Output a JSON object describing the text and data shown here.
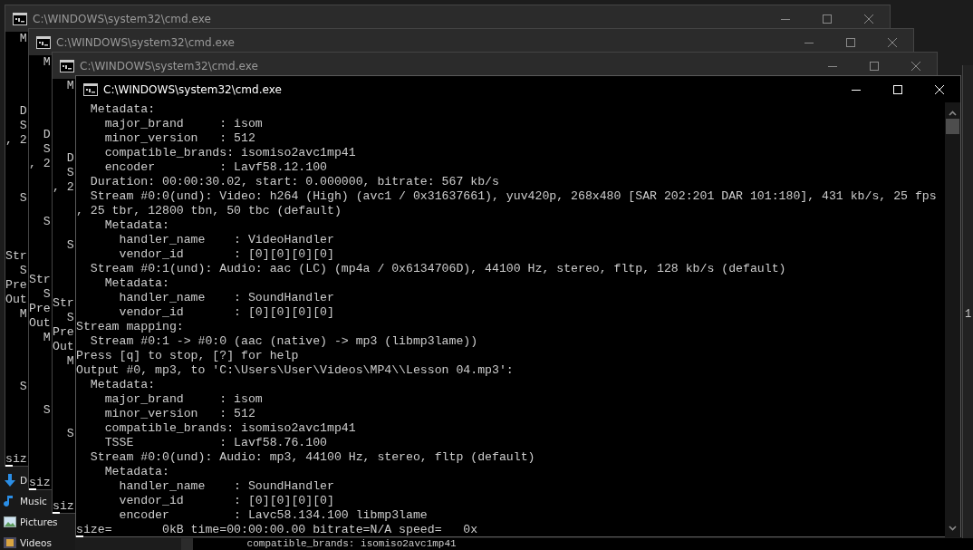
{
  "windows": [
    {
      "title": "C:\\WINDOWS\\system32\\cmd.exe",
      "active": false,
      "lines": [
        {
          "text": "  M"
        },
        {
          "kind": "blank"
        },
        {
          "kind": "blank"
        },
        {
          "kind": "blank"
        },
        {
          "kind": "blank"
        },
        {
          "text": "  D"
        },
        {
          "text": "  S"
        },
        {
          "text": ", 2"
        },
        {
          "kind": "blank"
        },
        {
          "kind": "blank"
        },
        {
          "kind": "blank"
        },
        {
          "text": "  S"
        },
        {
          "kind": "blank"
        },
        {
          "kind": "blank"
        },
        {
          "kind": "blank"
        },
        {
          "text": "Str"
        },
        {
          "text": "  S"
        },
        {
          "text": "Pre"
        },
        {
          "text": "Out"
        },
        {
          "text": "  M"
        },
        {
          "kind": "blank"
        },
        {
          "kind": "blank"
        },
        {
          "kind": "blank"
        },
        {
          "kind": "blank"
        },
        {
          "text": "  S"
        },
        {
          "kind": "blank"
        },
        {
          "kind": "blank"
        },
        {
          "kind": "blank"
        },
        {
          "kind": "blank"
        },
        {
          "text": "siz"
        }
      ]
    },
    {
      "title": "C:\\WINDOWS\\system32\\cmd.exe",
      "active": false,
      "lines": [
        {
          "text": "  M"
        },
        {
          "kind": "blank"
        },
        {
          "kind": "blank"
        },
        {
          "kind": "blank"
        },
        {
          "kind": "blank"
        },
        {
          "text": "  D"
        },
        {
          "text": "  S"
        },
        {
          "text": ", 2"
        },
        {
          "kind": "blank"
        },
        {
          "kind": "blank"
        },
        {
          "kind": "blank"
        },
        {
          "text": "  S"
        },
        {
          "kind": "blank"
        },
        {
          "kind": "blank"
        },
        {
          "kind": "blank"
        },
        {
          "text": "Str"
        },
        {
          "text": "  S"
        },
        {
          "text": "Pre"
        },
        {
          "text": "Out"
        },
        {
          "text": "  M"
        },
        {
          "kind": "blank"
        },
        {
          "kind": "blank"
        },
        {
          "kind": "blank"
        },
        {
          "kind": "blank"
        },
        {
          "text": "  S"
        },
        {
          "kind": "blank"
        },
        {
          "kind": "blank"
        },
        {
          "kind": "blank"
        },
        {
          "kind": "blank"
        },
        {
          "text": "siz"
        }
      ]
    },
    {
      "title": "C:\\WINDOWS\\system32\\cmd.exe",
      "active": false,
      "lines": [
        {
          "text": "  M"
        },
        {
          "kind": "blank"
        },
        {
          "kind": "blank"
        },
        {
          "kind": "blank"
        },
        {
          "kind": "blank"
        },
        {
          "text": "  D"
        },
        {
          "text": "  S"
        },
        {
          "text": ", 2"
        },
        {
          "kind": "blank"
        },
        {
          "kind": "blank"
        },
        {
          "kind": "blank"
        },
        {
          "text": "  S"
        },
        {
          "kind": "blank"
        },
        {
          "kind": "blank"
        },
        {
          "kind": "blank"
        },
        {
          "text": "Str"
        },
        {
          "text": "  S"
        },
        {
          "text": "Pre"
        },
        {
          "text": "Out"
        },
        {
          "text": "  M"
        },
        {
          "kind": "blank"
        },
        {
          "kind": "blank"
        },
        {
          "kind": "blank"
        },
        {
          "kind": "blank"
        },
        {
          "text": "  S"
        },
        {
          "kind": "blank"
        },
        {
          "kind": "blank"
        },
        {
          "kind": "blank"
        },
        {
          "kind": "blank"
        },
        {
          "text": "siz"
        }
      ]
    },
    {
      "title": "C:\\WINDOWS\\system32\\cmd.exe",
      "active": true,
      "lines": [
        {
          "text": "  Metadata:"
        },
        {
          "text": "    major_brand     : isom"
        },
        {
          "text": "    minor_version   : 512"
        },
        {
          "text": "    compatible_brands: isomiso2avc1mp41"
        },
        {
          "text": "    encoder         : Lavf58.12.100"
        },
        {
          "text": "  Duration: 00:00:30.02, start: 0.000000, bitrate: 567 kb/s"
        },
        {
          "text": "  Stream #0:0(und): Video: h264 (High) (avc1 / 0x31637661), yuv420p, 268x480 [SAR 202:201 DAR 101:180], 431 kb/s, 25 fps"
        },
        {
          "text": ", 25 tbr, 12800 tbn, 50 tbc (default)"
        },
        {
          "text": "    Metadata:"
        },
        {
          "text": "      handler_name    : VideoHandler"
        },
        {
          "text": "      vendor_id       : [0][0][0][0]"
        },
        {
          "text": "  Stream #0:1(und): Audio: aac (LC) (mp4a / 0x6134706D), 44100 Hz, stereo, fltp, 128 kb/s (default)"
        },
        {
          "text": "    Metadata:"
        },
        {
          "text": "      handler_name    : SoundHandler"
        },
        {
          "text": "      vendor_id       : [0][0][0][0]"
        },
        {
          "text": "Stream mapping:"
        },
        {
          "text": "  Stream #0:1 -> #0:0 (aac (native) -> mp3 (libmp3lame))"
        },
        {
          "text": "Press [q] to stop, [?] for help"
        },
        {
          "text": "Output #0, mp3, to 'C:\\Users\\User\\Videos\\MP4\\\\Lesson 04.mp3':"
        },
        {
          "text": "  Metadata:"
        },
        {
          "text": "    major_brand     : isom"
        },
        {
          "text": "    minor_version   : 512"
        },
        {
          "text": "    compatible_brands: isomiso2avc1mp41"
        },
        {
          "text": "    TSSE            : Lavf58.76.100"
        },
        {
          "text": "  Stream #0:0(und): Audio: mp3, 44100 Hz, stereo, fltp (default)"
        },
        {
          "text": "    Metadata:"
        },
        {
          "text": "      handler_name    : SoundHandler"
        },
        {
          "text": "      vendor_id       : [0][0][0][0]"
        },
        {
          "text": "      encoder         : Lavc58.134.100 libmp3lame"
        },
        {
          "text": "size=       0kB time=00:00:00.00 bitrate=N/A speed=   0x"
        }
      ]
    }
  ],
  "explorer": {
    "items": [
      {
        "label": "D",
        "kind": "download"
      },
      {
        "label": "Music",
        "kind": "music"
      },
      {
        "label": "Pictures",
        "kind": "pictures"
      },
      {
        "label": "Videos",
        "kind": "videos"
      }
    ]
  },
  "bottom_window": {
    "lines": [
      "      compatible_brands: isomiso2avc1mp41"
    ]
  },
  "side_window": {
    "text": "1"
  }
}
